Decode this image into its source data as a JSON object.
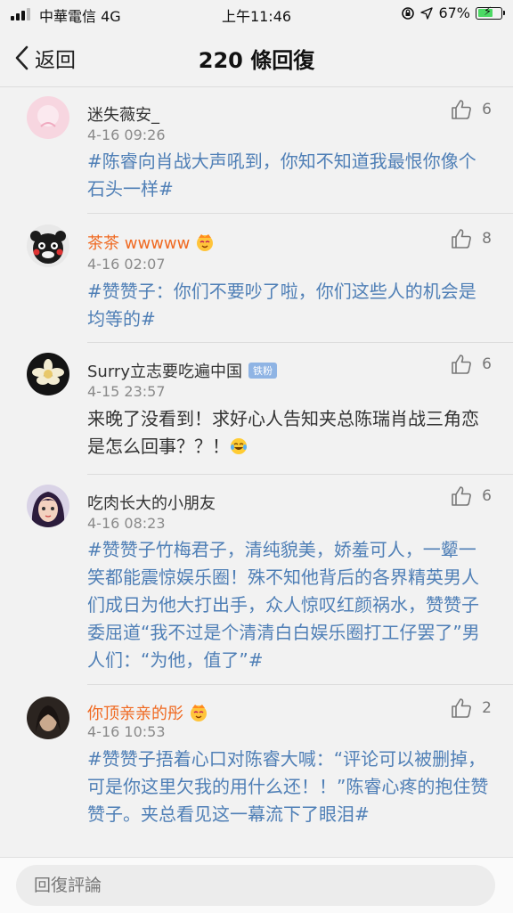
{
  "status_bar": {
    "carrier": "中華電信 4G",
    "time": "上午11:46",
    "battery_percent_label": "67%",
    "battery_level": 0.67,
    "battery_color": "#4cd964"
  },
  "nav": {
    "back_label": "返回",
    "title": "220 條回復"
  },
  "comments": [
    {
      "name": "迷失薇安_",
      "time": "4-16 09:26",
      "likes": "6",
      "text": "#陈睿向肖战大声吼到，你知不知道我最恨你像个石头一样#",
      "vip_icon": "",
      "badge": ""
    },
    {
      "name": "茶茶 wwwww",
      "time": "4-16 02:07",
      "likes": "8",
      "text": "#赞赞子：你们不要吵了啦，你们这些人的机会是均等的#",
      "vip_icon": "crown-face-icon",
      "badge": ""
    },
    {
      "name": "Surry立志要吃遍中国",
      "time": "4-15 23:57",
      "likes": "6",
      "text": "来晚了没看到！求好心人告知夹总陈瑞肖战三角恋是怎么回事？？！",
      "emoji_icon": "laughing-crying-emoji-icon",
      "badge": "铁粉"
    },
    {
      "name": "吃肉长大的小朋友",
      "time": "4-16 08:23",
      "likes": "6",
      "text": "#赞赞子竹梅君子，清纯貌美，娇羞可人，一颦一笑都能震惊娱乐圈！殊不知他背后的各界精英男人们成日为他大打出手，众人惊叹红颜祸水，赞赞子委屈道“我不过是个清清白白娱乐圈打工仔罢了”男人们：“为他，值了”#",
      "vip_icon": "",
      "badge": ""
    },
    {
      "name": "你顶亲亲的彤",
      "time": "4-16 10:53",
      "likes": "2",
      "text": "#赞赞子捂着心口对陈睿大喊：“评论可以被删掉，可是你这里欠我的用什么还！！”陈睿心疼的抱住赞赞子。夹总看见这一幕流下了眼泪#",
      "vip_icon": "crown-face-icon",
      "badge": ""
    }
  ],
  "reply": {
    "placeholder": "回復評論"
  }
}
